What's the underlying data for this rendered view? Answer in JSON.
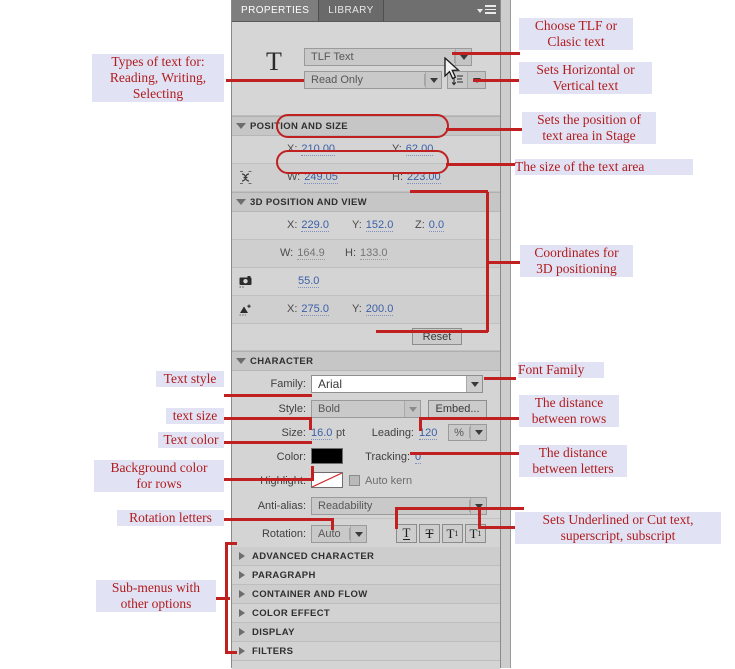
{
  "panel": {
    "tabs": [
      {
        "label": "PROPERTIES",
        "active": true
      },
      {
        "label": "LIBRARY",
        "active": false
      }
    ],
    "menu_icon": "panel-menu-icon",
    "text_tool_icon": "text-tool-T-icon"
  },
  "text_type": {
    "engine_value": "TLF Text",
    "engine_placeholder": "TLF Text",
    "behavior_value": "Read Only",
    "behavior_placeholder": "Read Only",
    "direction_icon": "vertical-text-direction-icon"
  },
  "position_and_size": {
    "header": "POSITION AND SIZE",
    "lock_icon": "constrain-proportions-icon",
    "x_label": "X:",
    "x_value": "210.00",
    "y_label": "Y:",
    "y_value": "62.00",
    "w_label": "W:",
    "w_value": "249.05",
    "h_label": "H:",
    "h_value": "223.00"
  },
  "position_3d": {
    "header": "3D POSITION AND VIEW",
    "x_label": "X:",
    "x_value": "229.0",
    "y_label": "Y:",
    "y_value": "152.0",
    "z_label": "Z:",
    "z_value": "0.0",
    "w_label": "W:",
    "w_value": "164.9",
    "h_label": "H:",
    "h_value": "133.0",
    "camera_icon": "camera-perspective-angle-icon",
    "perspective_value": "55.0",
    "vanishing_icon": "vanishing-point-icon",
    "vp_x_label": "X:",
    "vp_x_value": "275.0",
    "vp_y_label": "Y:",
    "vp_y_value": "200.0",
    "reset_label": "Reset"
  },
  "character": {
    "header": "CHARACTER",
    "family_label": "Family:",
    "family_value": "Arial",
    "style_label": "Style:",
    "style_value": "Bold",
    "embed_label": "Embed...",
    "size_label": "Size:",
    "size_value": "16.0",
    "size_unit": "pt",
    "leading_label": "Leading:",
    "leading_value": "120",
    "leading_unit": "%",
    "color_label": "Color:",
    "color_value": "#000000",
    "tracking_label": "Tracking:",
    "tracking_value": "0",
    "highlight_label": "Highlight:",
    "highlight_value": "none",
    "auto_kern_label": "Auto kern",
    "auto_kern_checked": false,
    "antialias_label": "Anti-alias:",
    "antialias_value": "Readability",
    "rotation_label": "Rotation:",
    "rotation_value": "Auto",
    "style_buttons": [
      {
        "glyph": "T",
        "name": "underline-button"
      },
      {
        "glyph": "T",
        "name": "strikethrough-button"
      },
      {
        "glyph": "T",
        "name": "superscript-button"
      },
      {
        "glyph": "T",
        "name": "subscript-button"
      }
    ]
  },
  "sub_sections": [
    {
      "label": "ADVANCED CHARACTER"
    },
    {
      "label": "PARAGRAPH"
    },
    {
      "label": "CONTAINER AND FLOW"
    },
    {
      "label": "COLOR EFFECT"
    },
    {
      "label": "DISPLAY"
    },
    {
      "label": "FILTERS"
    }
  ],
  "annotations": {
    "left": [
      {
        "text": "Types of text for:\nReading, Writing,\nSelecting"
      },
      {
        "text": "Text style"
      },
      {
        "text": "text size"
      },
      {
        "text": "Text color"
      },
      {
        "text": "Background color\nfor rows"
      },
      {
        "text": "Rotation letters"
      },
      {
        "text": "Sub-menus with\nother options"
      }
    ],
    "right": [
      {
        "text": "Choose TLF or\nClasic text"
      },
      {
        "text": "Sets Horizontal or\nVertical text"
      },
      {
        "text": "Sets the position of\ntext area in Stage"
      },
      {
        "text": "The size of the text area"
      },
      {
        "text": "Coordinates for\n3D positioning"
      },
      {
        "text": "Font Family"
      },
      {
        "text": "The distance\nbetween rows"
      },
      {
        "text": "The distance\nbetween letters"
      },
      {
        "text": "Sets Underlined or Cut text,\nsuperscript, subscript"
      }
    ]
  },
  "colors": {
    "annotation_text": "#b01c1c",
    "annotation_bg": "#e2e2f5",
    "callout_line": "#c0201f",
    "value_link": "#3b5fa8",
    "panel_bg": "#d4d4d4"
  }
}
